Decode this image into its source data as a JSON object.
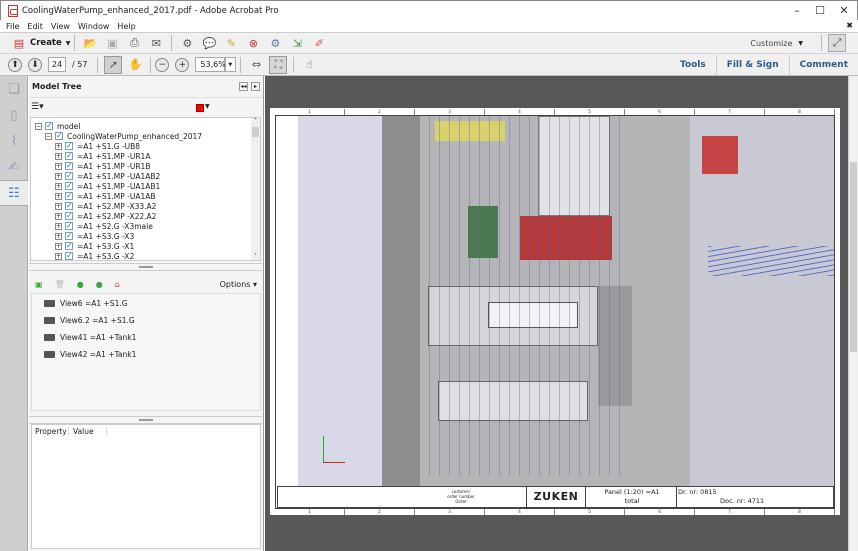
{
  "window": {
    "title": "CoolingWaterPump_enhanced_2017.pdf - Adobe Acrobat Pro",
    "minimize": "–",
    "maximize": "☐",
    "close": "✕",
    "close_doc": "✖"
  },
  "menu": [
    "File",
    "Edit",
    "View",
    "Window",
    "Help"
  ],
  "toolbar": {
    "create_label": "Create",
    "customize_label": "Customize"
  },
  "nav": {
    "page_current": "24",
    "page_total": "/ 57",
    "zoom": "53,6%"
  },
  "right_links": {
    "tools": "Tools",
    "fill_sign": "Fill & Sign",
    "comment": "Comment"
  },
  "panel": {
    "title": "Model Tree",
    "color_swatch": "#ff0000",
    "tree": {
      "root": "model",
      "child": "CoolingWaterPump_enhanced_2017",
      "items": [
        "=A1 +S1.G -UB8",
        "=A1 +S1.MP -UR1A",
        "=A1 +S1.MP -UR1B",
        "=A1 +S1.MP -UA1AB2",
        "=A1 +S1.MP -UA1AB1",
        "=A1 +S1.MP -UA1AB",
        "=A1 +S2.MP -X33.A2",
        "=A1 +S2.MP -X22.A2",
        "=A1 +S2.G -X3male",
        "=A1 +S3.G -X3",
        "=A1 +S3.G -X1",
        "=A1 +S3.G -X2"
      ]
    },
    "views_options": "Options",
    "views": [
      "View6 =A1 +S1.G",
      "View6.2 =A1 +S1.G",
      "View41 =A1 +Tank1",
      "View42 =A1 +Tank1"
    ],
    "properties": {
      "col_property": "Property",
      "col_value": "Value"
    }
  },
  "document": {
    "zone_numbers": [
      "1",
      "2",
      "3",
      "4",
      "5",
      "6",
      "7",
      "8"
    ],
    "title_block": {
      "logo": "ZUKEN",
      "panel": "Panel (1:20) =A1",
      "total": "total",
      "drawing_nr": "Dr. nr: 0815",
      "doc_nr": "Doc. nr: 4711",
      "customer": "customer",
      "order_number": "order number",
      "order": "Order"
    }
  }
}
